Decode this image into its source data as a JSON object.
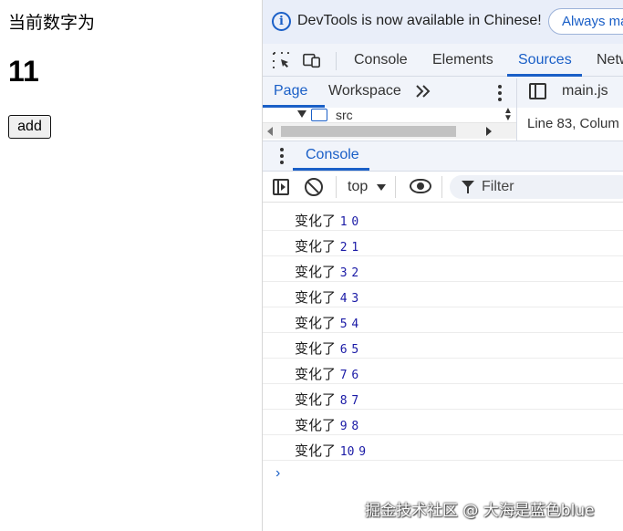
{
  "left_page": {
    "label": "当前数字为",
    "number": "11",
    "add_button": "add"
  },
  "devtools": {
    "infobar": {
      "message": "DevTools is now available in Chinese!",
      "button": "Always ma"
    },
    "main_tabs": [
      "Console",
      "Elements",
      "Sources",
      "Netw"
    ],
    "active_main_tab": "Sources",
    "sources": {
      "sub_tabs": [
        "Page",
        "Workspace"
      ],
      "tree_item": "src",
      "open_file": "main.js",
      "status": "Line 83, Colum"
    },
    "drawer": {
      "tab": "Console"
    },
    "console_toolbar": {
      "context": "top",
      "filter_placeholder": "Filter"
    },
    "console_logs": [
      {
        "text": "变化了",
        "a": "1",
        "b": "0"
      },
      {
        "text": "变化了",
        "a": "2",
        "b": "1"
      },
      {
        "text": "变化了",
        "a": "3",
        "b": "2"
      },
      {
        "text": "变化了",
        "a": "4",
        "b": "3"
      },
      {
        "text": "变化了",
        "a": "5",
        "b": "4"
      },
      {
        "text": "变化了",
        "a": "6",
        "b": "5"
      },
      {
        "text": "变化了",
        "a": "7",
        "b": "6"
      },
      {
        "text": "变化了",
        "a": "8",
        "b": "7"
      },
      {
        "text": "变化了",
        "a": "9",
        "b": "8"
      },
      {
        "text": "变化了",
        "a": "10",
        "b": "9"
      }
    ],
    "prompt": "›"
  },
  "watermark": "掘金技术社区 @ 大海是蓝色blue",
  "colors": {
    "accent": "#1a5fc7",
    "log_number": "#1a1aa6",
    "toolbar_bg": "#f1f4fa",
    "infobar_bg": "#e9eef9"
  }
}
